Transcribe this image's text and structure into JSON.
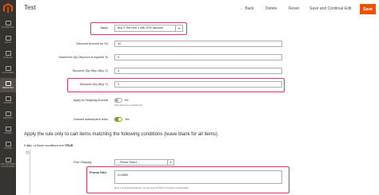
{
  "sidebar": {
    "items": [
      {
        "label": "Dashboard",
        "icon": "dashboard-icon"
      },
      {
        "label": "Sales",
        "icon": "dollar-icon"
      },
      {
        "label": "Catalog",
        "icon": "box-icon"
      },
      {
        "label": "Customers",
        "icon": "user-icon"
      },
      {
        "label": "Marketing",
        "icon": "megaphone-icon",
        "active": true
      },
      {
        "label": "Content",
        "icon": "layout-icon"
      },
      {
        "label": "Reports",
        "icon": "bar-chart-icon"
      },
      {
        "label": "Stores",
        "icon": "store-icon"
      },
      {
        "label": "System",
        "icon": "gear-icon"
      },
      {
        "label": "Find Partners & Extensions",
        "icon": "puzzle-icon"
      }
    ]
  },
  "header": {
    "title": "Test",
    "back_label": "Back",
    "delete_label": "Delete",
    "reset_label": "Reset",
    "save_continue_label": "Save and Continue Edit",
    "save_label": "Save"
  },
  "form": {
    "apply": {
      "label": "Apply",
      "value": "Buy X Get next 1 with 10% discount"
    },
    "discount_amount": {
      "label": "Discount Amount (in %)",
      "value": "10"
    },
    "max_qty": {
      "label": "Maximum Qty Discount is Applied To",
      "value": "3"
    },
    "discount_qty_step": {
      "label": "Discount Qty Step (Buy X)",
      "value": "3"
    },
    "discount_qty_buy_y": {
      "label": "Discount Qty (Buy Y)",
      "value": "2"
    },
    "apply_shipping": {
      "label": "Apply to Shipping Amount",
      "state": "No",
      "note": "Apply discount to subtotal only"
    },
    "discard_subsequent": {
      "label": "Discard subsequent rules",
      "state": "Yes"
    }
  },
  "conditions": {
    "title": "Apply the rule only to cart items matching the following conditions (leave blank for all items).",
    "if_prefix": "If",
    "aggregator": "ALL",
    "middle_text": "of these conditions are",
    "value": "TRUE",
    "suffix": ":",
    "option_label": "Free Shipping",
    "option_select": "-- Please Select --",
    "sku_label": "Promo SKU",
    "sku_value": "24-MB01",
    "sku_note": "Enter 1 products separated by comma. Enter All SKUs if product is Customizable."
  },
  "colors": {
    "accent": "#eb5202",
    "highlight": "#dd3363",
    "sidebar": "#373330",
    "toggle_on": "#79a22e"
  }
}
